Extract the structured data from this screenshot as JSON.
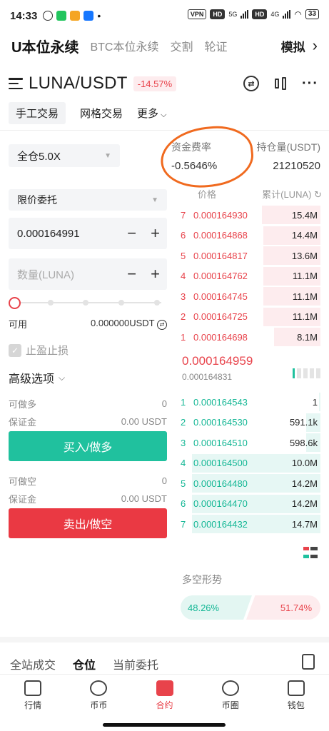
{
  "status": {
    "time": "14:33",
    "vpn": "VPN",
    "hd": "HD",
    "net1": "5G",
    "net2": "4G",
    "battery": "33"
  },
  "top_nav": {
    "tabs": [
      "U本位永续",
      "BTC本位永续",
      "交割",
      "轮证"
    ],
    "right_label": "模拟",
    "right_arrow": "›"
  },
  "pair": {
    "name": "LUNA/USDT",
    "change": "-14.57%"
  },
  "modes": {
    "manual": "手工交易",
    "grid": "网格交易",
    "more": "更多"
  },
  "form": {
    "leverage": "全仓5.0X",
    "order_type": "限价委托",
    "price": "0.000164991",
    "qty_placeholder": "数量(LUNA)",
    "minus": "−",
    "plus": "+",
    "available_label": "可用",
    "available_value": "0.000000USDT",
    "tpsl_label": "止盈止损",
    "advanced_label": "高级选项",
    "long_label": "可做多",
    "long_value": "0",
    "margin_label": "保证金",
    "margin_value_long": "0.00 USDT",
    "buy_button": "买入/做多",
    "short_label": "可做空",
    "short_value": "0",
    "margin_value_short": "0.00 USDT",
    "sell_button": "卖出/做空"
  },
  "funding": {
    "label": "资金费率",
    "value": "-0.5646%"
  },
  "open_interest": {
    "label": "持仓量(USDT)",
    "value": "21210520"
  },
  "orderbook": {
    "price_header": "价格",
    "qty_header": "累计(LUNA)",
    "asks": [
      {
        "i": "7",
        "price": "0.000164930",
        "qty": "15.4M",
        "depth": 0.42
      },
      {
        "i": "6",
        "price": "0.000164868",
        "qty": "14.4M",
        "depth": 0.41
      },
      {
        "i": "5",
        "price": "0.000164817",
        "qty": "13.6M",
        "depth": 0.41
      },
      {
        "i": "4",
        "price": "0.000164762",
        "qty": "11.1M",
        "depth": 0.41
      },
      {
        "i": "3",
        "price": "0.000164745",
        "qty": "11.1M",
        "depth": 0.41
      },
      {
        "i": "2",
        "price": "0.000164725",
        "qty": "11.1M",
        "depth": 0.41
      },
      {
        "i": "1",
        "price": "0.000164698",
        "qty": "8.1M",
        "depth": 0.33
      }
    ],
    "last_price": "0.000164959",
    "mark_price": "0.000164831",
    "bids": [
      {
        "i": "1",
        "price": "0.000164543",
        "qty": "1",
        "depth": 0.01
      },
      {
        "i": "2",
        "price": "0.000164530",
        "qty": "591.1k",
        "depth": 0.1
      },
      {
        "i": "3",
        "price": "0.000164510",
        "qty": "598.6k",
        "depth": 0.1
      },
      {
        "i": "4",
        "price": "0.000164500",
        "qty": "10.0M",
        "depth": 0.92
      },
      {
        "i": "5",
        "price": "0.000164480",
        "qty": "14.2M",
        "depth": 0.92
      },
      {
        "i": "6",
        "price": "0.000164470",
        "qty": "14.2M",
        "depth": 0.92
      },
      {
        "i": "7",
        "price": "0.000164432",
        "qty": "14.7M",
        "depth": 0.92
      }
    ]
  },
  "trend": {
    "label": "多空形势",
    "long_pct": "48.26%",
    "short_pct": "51.74%"
  },
  "bottom_tabs": [
    "全站成交",
    "仓位",
    "当前委托"
  ],
  "tabbar": [
    "行情",
    "币币",
    "合约",
    "币圈",
    "钱包"
  ],
  "colors": {
    "red": "#e8434b",
    "green": "#20c19e",
    "annotation": "#f06a1f"
  }
}
